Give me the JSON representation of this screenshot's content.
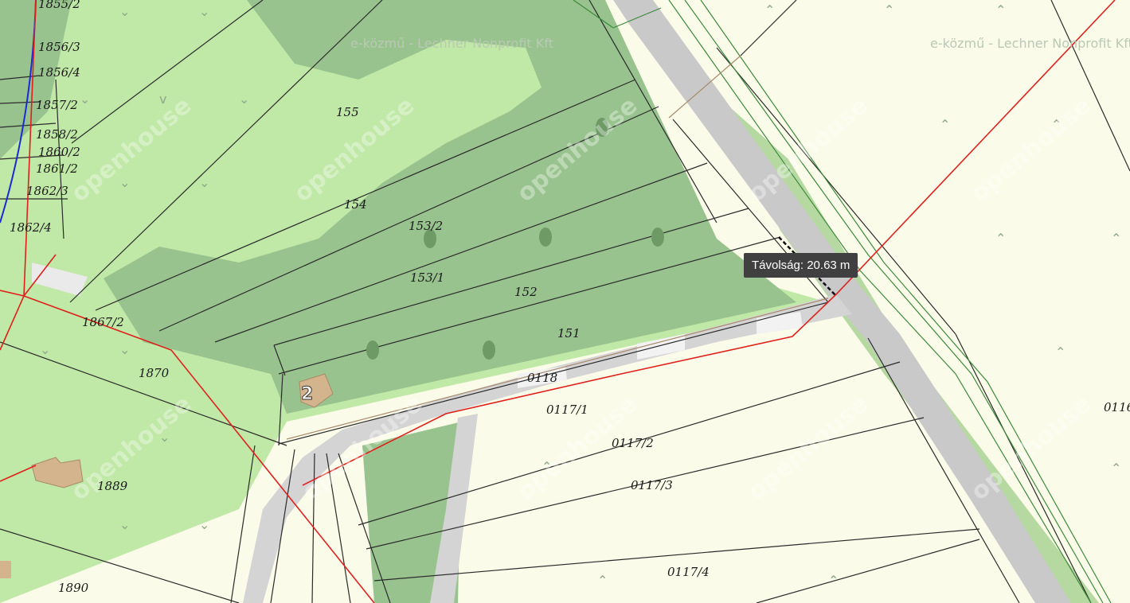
{
  "attribution": "e-közmű - Lechner Nonprofit Kft",
  "watermark": "openhouse",
  "tooltip": {
    "label": "Távolság:",
    "value": "20.63 m"
  },
  "building_label": "2",
  "parcels": [
    "1855/2",
    "1856/3",
    "1856/4",
    "1857/2",
    "1858/2",
    "1860/2",
    "1861/2",
    "1862/3",
    "1862/4",
    "1867/2",
    "1870",
    "1889",
    "1890",
    "155",
    "154",
    "153/2",
    "153/1",
    "152",
    "151",
    "0118",
    "0117/1",
    "0117/2",
    "0117/3",
    "0117/4",
    "0116"
  ],
  "colors": {
    "forest": "#98c38e",
    "meadow": "#c0e8a6",
    "arable": "#fbfbe9",
    "road": "#c9c9c9",
    "red_line": "#e0201c",
    "green_line": "#3c8a3c",
    "blue_line": "#1a2bd6"
  }
}
